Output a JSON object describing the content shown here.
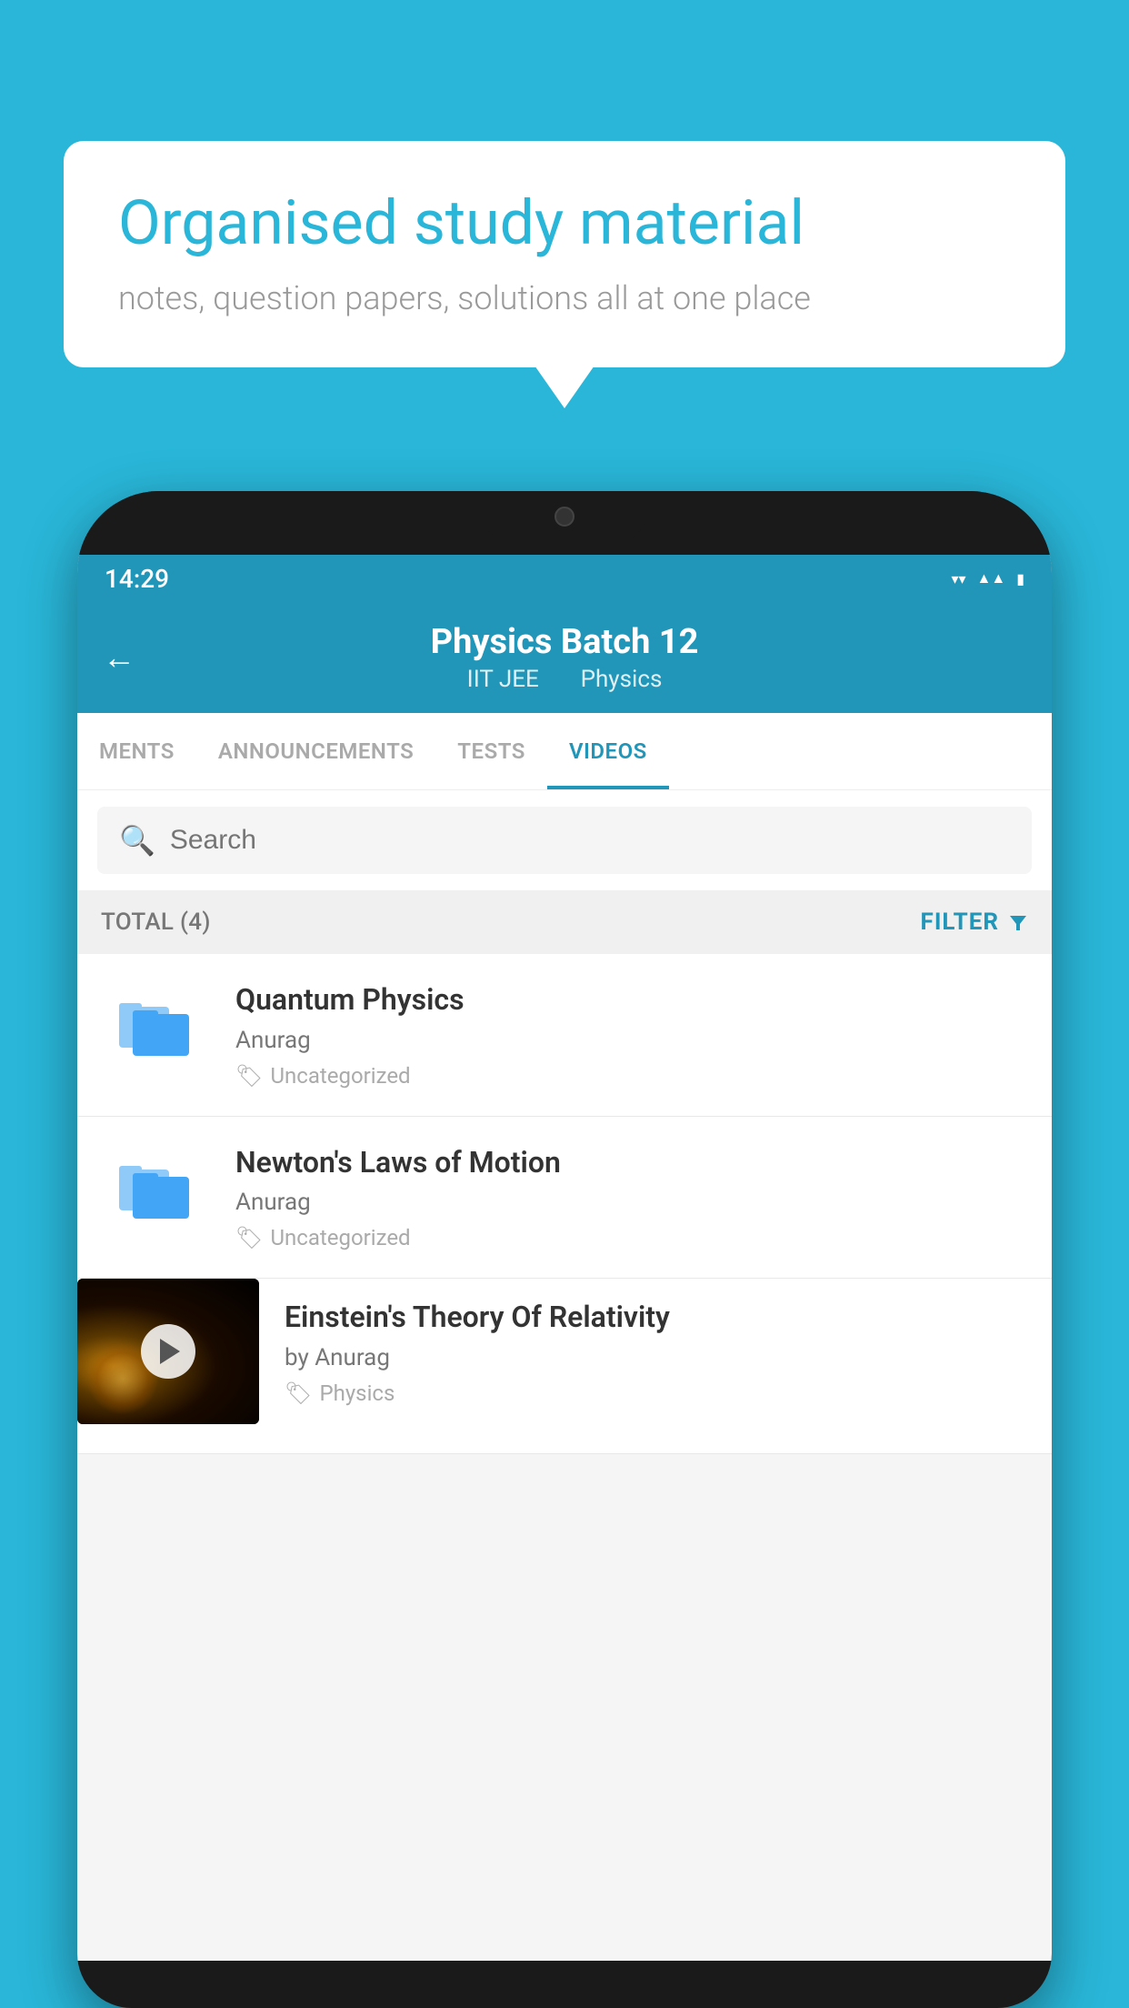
{
  "background_color": "#29b6d8",
  "speech_bubble": {
    "heading": "Organised study material",
    "subtext": "notes, question papers, solutions all at one place"
  },
  "status_bar": {
    "time": "14:29",
    "wifi": "▼",
    "signal": "▲",
    "battery": "▮"
  },
  "app_header": {
    "back_label": "←",
    "title": "Physics Batch 12",
    "subtitle_left": "IIT JEE",
    "subtitle_right": "Physics"
  },
  "tabs": [
    {
      "label": "MENTS",
      "active": false
    },
    {
      "label": "ANNOUNCEMENTS",
      "active": false
    },
    {
      "label": "TESTS",
      "active": false
    },
    {
      "label": "VIDEOS",
      "active": true
    }
  ],
  "search": {
    "placeholder": "Search"
  },
  "filter_bar": {
    "total_label": "TOTAL (4)",
    "filter_label": "FILTER"
  },
  "videos": [
    {
      "id": 1,
      "title": "Quantum Physics",
      "author": "Anurag",
      "tag": "Uncategorized",
      "type": "folder"
    },
    {
      "id": 2,
      "title": "Newton's Laws of Motion",
      "author": "Anurag",
      "tag": "Uncategorized",
      "type": "folder"
    },
    {
      "id": 3,
      "title": "Einstein's Theory Of Relativity",
      "author_prefix": "by",
      "author": "Anurag",
      "tag": "Physics",
      "type": "video"
    }
  ]
}
